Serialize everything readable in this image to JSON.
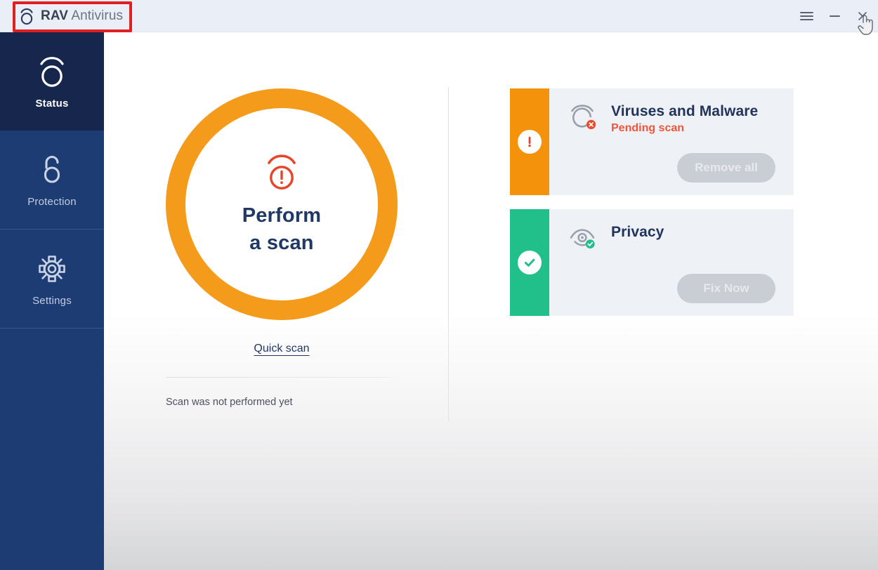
{
  "window": {
    "brand_mark": "rav-logo",
    "brand_bold": "RAV",
    "brand_rest": "Antivirus",
    "controls": {
      "menu": "menu-icon",
      "minimize": "minimize-icon",
      "close": "close-icon"
    }
  },
  "sidebar": {
    "items": [
      {
        "label": "Status",
        "icon": "rav-ring-icon",
        "active": true
      },
      {
        "label": "Protection",
        "icon": "unlocked-padlock-icon",
        "active": false
      },
      {
        "label": "Settings",
        "icon": "gear-icon",
        "active": false
      }
    ]
  },
  "scan": {
    "icon": "alert-ring-icon",
    "title_line1": "Perform",
    "title_line2": "a scan",
    "quick_scan_link": "Quick scan",
    "status_text": "Scan was not performed yet"
  },
  "cards": [
    {
      "title": "Viruses and Malware",
      "subtitle": "Pending scan",
      "button": "Remove all",
      "status": "warning",
      "strip_icon": "exclamation-badge-icon",
      "item_icon": "virus-scan-icon",
      "strip_color": "#f5920c",
      "subtitle_color": "#f0553b"
    },
    {
      "title": "Privacy",
      "subtitle": "",
      "button": "Fix Now",
      "status": "ok",
      "strip_icon": "check-badge-icon",
      "item_icon": "eye-privacy-icon",
      "strip_color": "#21c08a",
      "subtitle_color": ""
    }
  ],
  "annotation": {
    "type": "highlight-rectangle",
    "color": "#e02020",
    "target": "brand-logo"
  },
  "colors": {
    "sidebar": "#1d3c73",
    "sidebar_active": "#16264d",
    "accent_orange": "#f59b1c",
    "title_navy": "#1f3864",
    "titlebar": "#eaeff7"
  }
}
